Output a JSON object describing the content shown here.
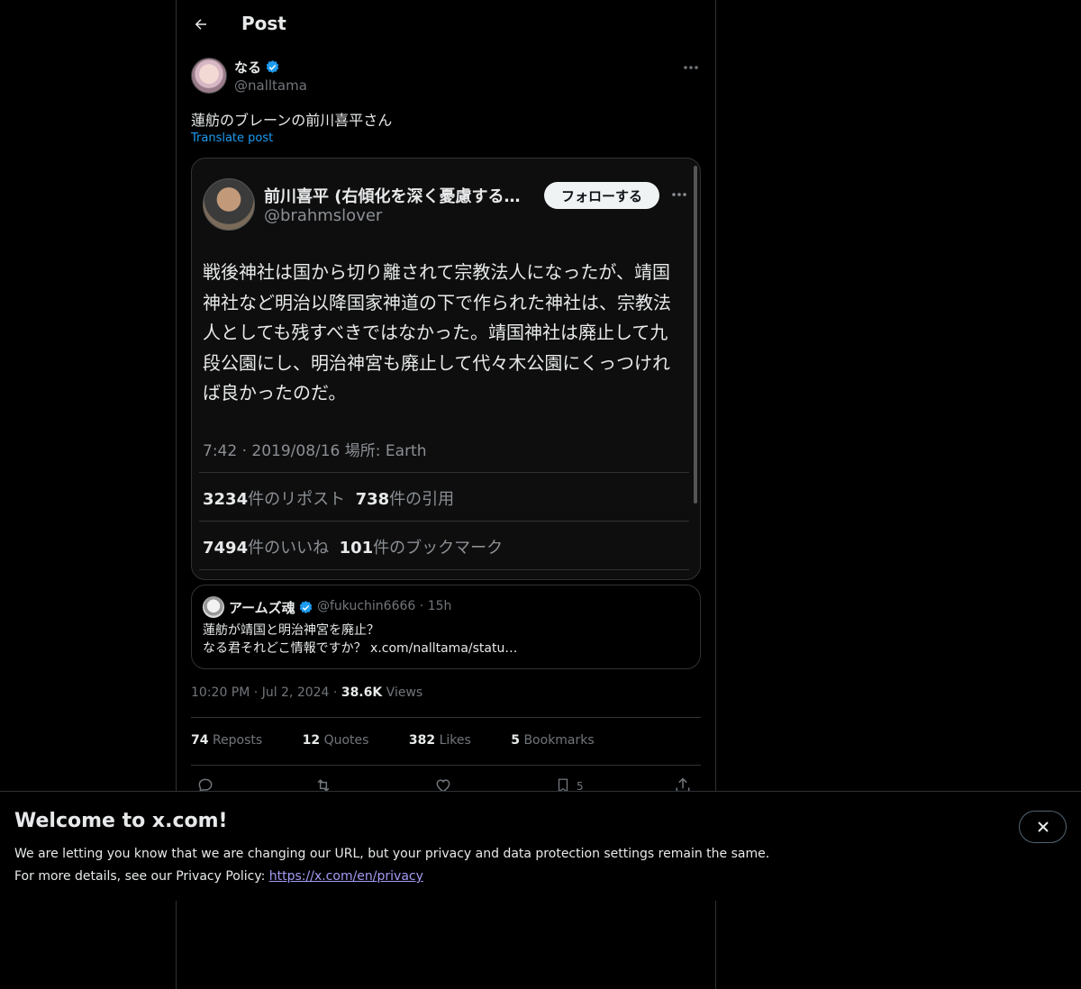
{
  "header": {
    "title": "Post"
  },
  "author": {
    "name": "なる",
    "handle": "@nalltama"
  },
  "post": {
    "text": "蓮舫のブレーンの前川喜平さん",
    "translate_label": "Translate post"
  },
  "embedded_screenshot": {
    "name": "前川喜平 (右傾化を深く憂慮する…",
    "handle": "@brahmslover",
    "follow_label": "フォローする",
    "body": "戦後神社は国から切り離されて宗教法人になったが、靖国神社など明治以降国家神道の下で作られた神社は、宗教法人としても残すべきではなかった。靖国神社は廃止して九段公園にし、明治神宮も廃止して代々木公園にくっつければ良かったのだ。",
    "meta": "7:42 · 2019/08/16 場所: Earth",
    "reposts_count": "3234",
    "reposts_label": "件のリポスト",
    "quotes_count": "738",
    "quotes_label": "件の引用",
    "likes_count": "7494",
    "likes_label": "件のいいね",
    "bookmarks_count": "101",
    "bookmarks_label": "件のブックマーク"
  },
  "quote": {
    "name": "アームズ魂",
    "handle": "@fukuchin6666",
    "time": "15h",
    "text": "蓮舫が靖国と明治神宮を廃止？\nなる君それどこ情報ですか？ x.com/nalltama/statu…"
  },
  "meta": {
    "time": "10:20 PM",
    "date": "Jul 2, 2024",
    "views_count": "38.6K",
    "views_label": "Views"
  },
  "stats": {
    "reposts_count": "74",
    "reposts_label": "Reposts",
    "quotes_count": "12",
    "quotes_label": "Quotes",
    "likes_count": "382",
    "likes_label": "Likes",
    "bookmarks_count": "5",
    "bookmarks_label": "Bookmarks"
  },
  "actions": {
    "bookmark_count": "5"
  },
  "banner": {
    "title": "Welcome to x.com!",
    "line1": "We are letting you know that we are changing our URL, but your privacy and data protection settings remain the same.",
    "line2_prefix": "For more details, see our Privacy Policy: ",
    "link": "https://x.com/en/privacy"
  },
  "colors": {
    "accent": "#1d9bf0",
    "link": "#a29cf4",
    "background": "#000000",
    "muted": "#71767b"
  }
}
